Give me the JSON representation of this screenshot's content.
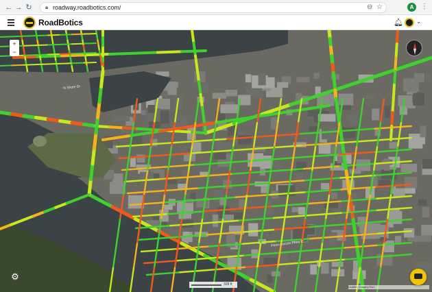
{
  "browser": {
    "url": "roadway.roadbotics.com/",
    "profile_initial": "A"
  },
  "header": {
    "brand": "RoadBotics"
  },
  "map": {
    "zoom_in": "+",
    "zoom_out": "−",
    "scale_label": "328 ft",
    "attribution": "Leaflet | Imagery Esri",
    "street_labels": [
      "Penn-Lincoln Pkwy E",
      "N Shore Dr"
    ],
    "rating_colors": {
      "good": "#3fd12e",
      "fair": "#c7e81c",
      "moderate": "#f6b21b",
      "poor": "#ef5a1b"
    },
    "water_color": "#3b4346"
  }
}
